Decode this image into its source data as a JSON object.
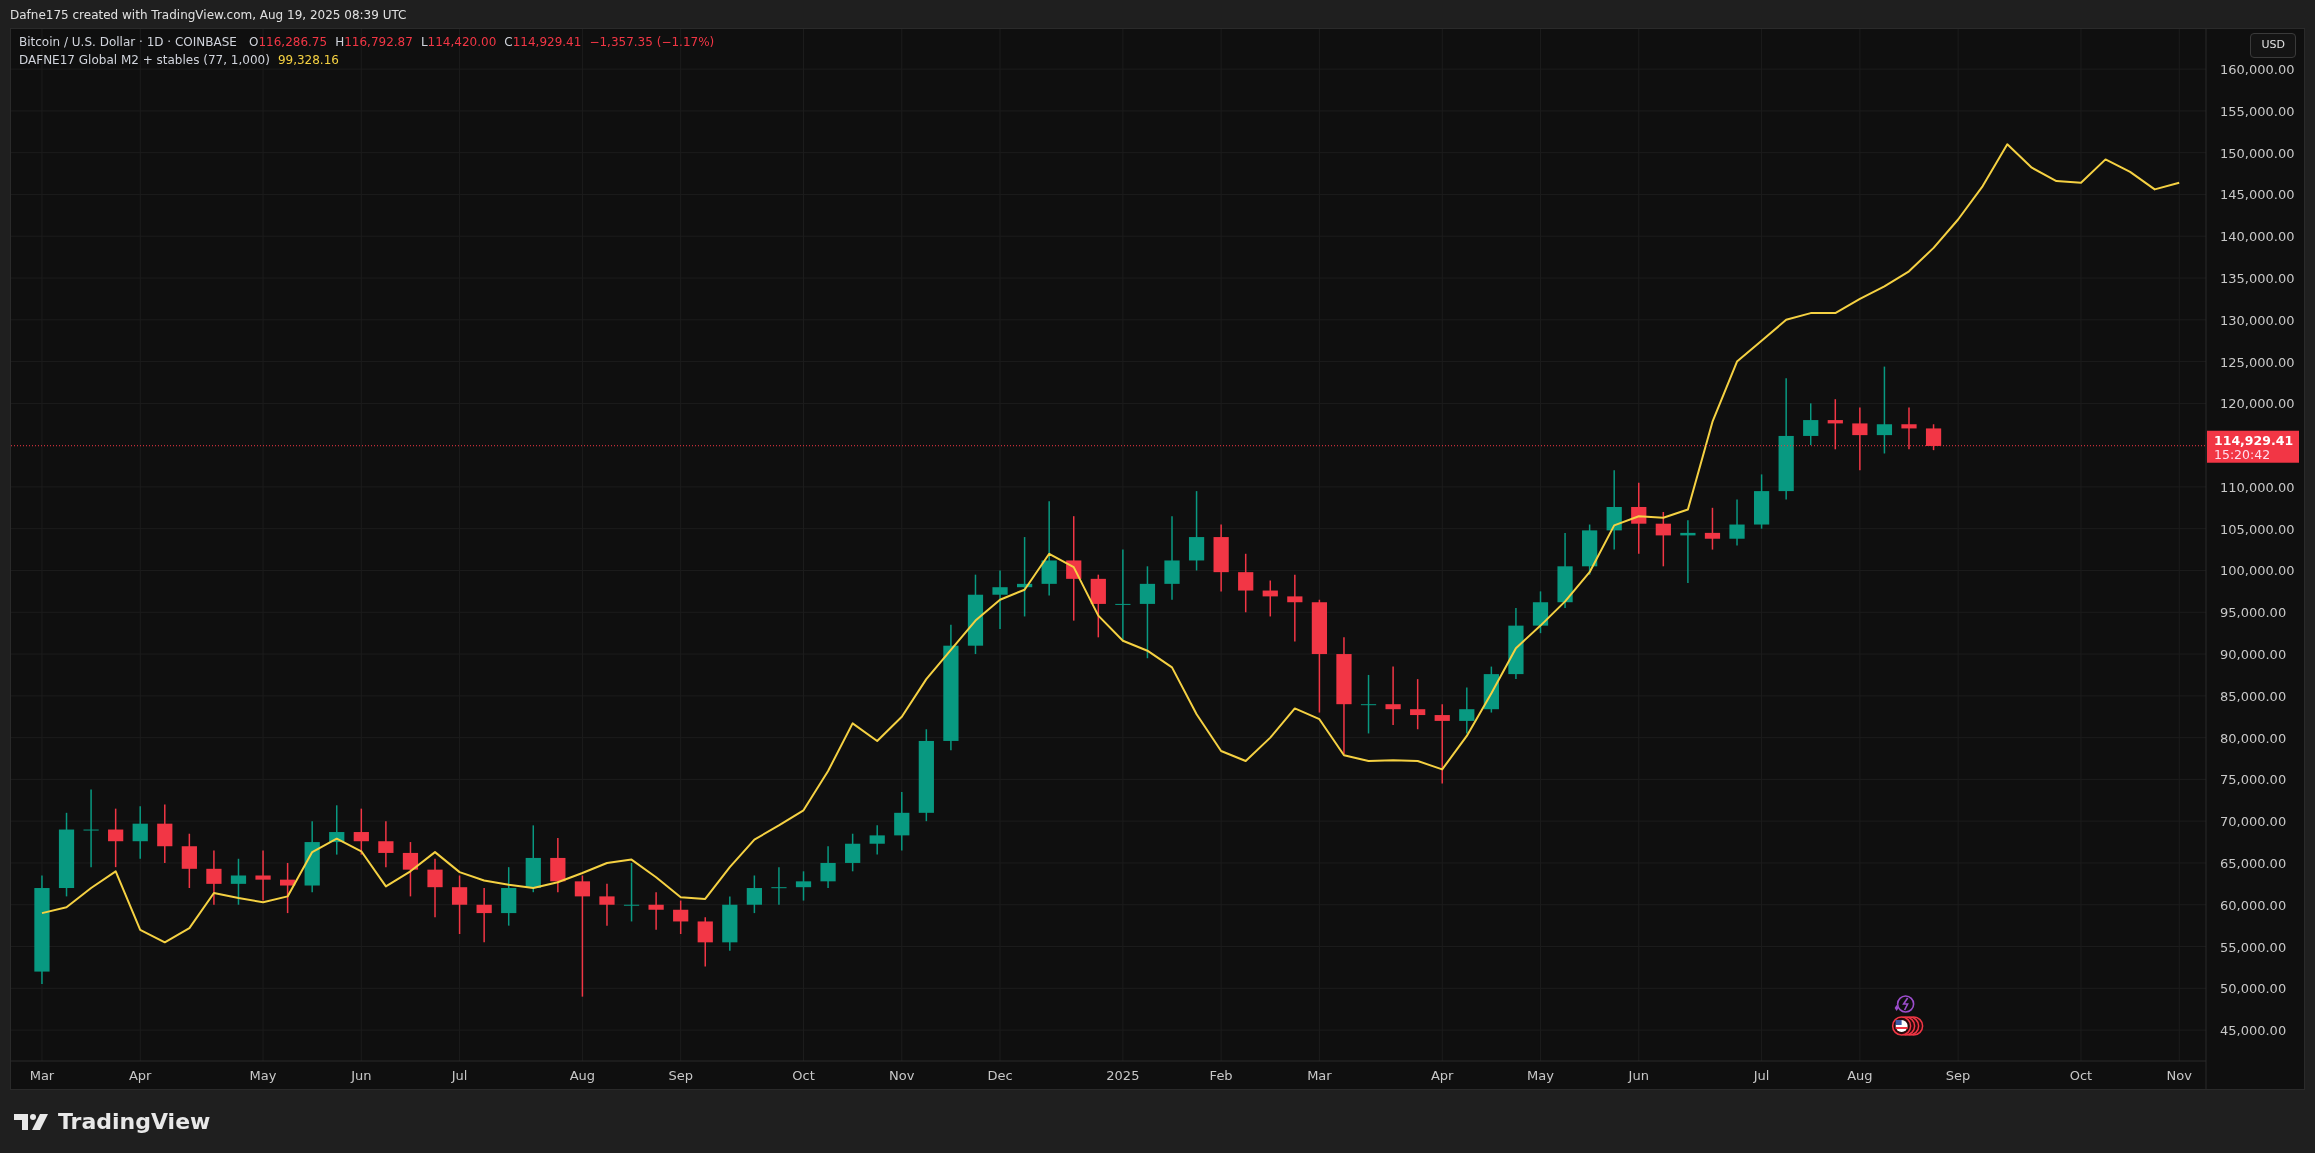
{
  "attribution": "Dafne175 created with TradingView.com, Aug 19, 2025 08:39 UTC",
  "legend": {
    "symbol": "Bitcoin / U.S. Dollar · 1D · COINBASE",
    "ohlc": [
      {
        "label": "O",
        "value": "116,286.75"
      },
      {
        "label": "H",
        "value": "116,792.87"
      },
      {
        "label": "L",
        "value": "114,420.00"
      },
      {
        "label": "C",
        "value": "114,929.41"
      }
    ],
    "change": "−1,357.35 (−1.17%)",
    "indicator": {
      "value": "99,328.16"
    }
  },
  "currency_button": "USD",
  "last_price": {
    "countdown": "15:20:42"
  },
  "chart_data": {
    "type": "candlestick",
    "ylim": [
      41300,
      164800
    ],
    "grid": true,
    "ref_lines": [
      {
        "axis": "y",
        "value": 114929.41,
        "label": "114,929.41",
        "color": "#f23645"
      }
    ],
    "categories": [
      "Mar",
      null,
      null,
      null,
      "Apr",
      null,
      null,
      null,
      null,
      "May",
      null,
      null,
      null,
      "Jun",
      null,
      null,
      null,
      "Jul",
      null,
      null,
      null,
      null,
      "Aug",
      null,
      null,
      null,
      "Sep",
      null,
      null,
      null,
      null,
      "Oct",
      null,
      null,
      null,
      "Nov",
      null,
      null,
      null,
      "Dec",
      null,
      null,
      null,
      null,
      "2025",
      null,
      null,
      null,
      "Feb",
      null,
      null,
      null,
      "Mar",
      null,
      null,
      null,
      null,
      "Apr",
      null,
      null,
      null,
      "May",
      null,
      null,
      null,
      "Jun",
      null,
      null,
      null,
      null,
      "Jul",
      null,
      null,
      null,
      "Aug",
      null,
      null,
      null,
      "Sep",
      null,
      null,
      null,
      null,
      "Oct",
      null,
      null,
      null,
      "Nov"
    ],
    "ohlc": [
      [
        52000,
        63500,
        50500,
        62000
      ],
      [
        62000,
        71000,
        61000,
        69000
      ],
      [
        69000,
        73800,
        64500,
        69000
      ],
      [
        69000,
        71500,
        64500,
        67600
      ],
      [
        67600,
        71800,
        65500,
        69700
      ],
      [
        69700,
        72000,
        65000,
        67000
      ],
      [
        67000,
        68500,
        62000,
        64300
      ],
      [
        64300,
        66500,
        60000,
        62500
      ],
      [
        62500,
        65500,
        60000,
        63500
      ],
      [
        63500,
        66500,
        60500,
        63000
      ],
      [
        63000,
        65000,
        59000,
        62300
      ],
      [
        62300,
        70000,
        61500,
        67500
      ],
      [
        67500,
        71900,
        66000,
        68700
      ],
      [
        68700,
        71500,
        66000,
        67600
      ],
      [
        67600,
        70000,
        64500,
        66200
      ],
      [
        66200,
        67500,
        61000,
        64200
      ],
      [
        64200,
        65500,
        58500,
        62100
      ],
      [
        62100,
        63500,
        56500,
        60000
      ],
      [
        60000,
        62000,
        55500,
        59000
      ],
      [
        59000,
        64500,
        57500,
        62000
      ],
      [
        62000,
        69500,
        61500,
        65600
      ],
      [
        65600,
        68000,
        61500,
        62800
      ],
      [
        62800,
        63500,
        49000,
        61000
      ],
      [
        61000,
        62500,
        57500,
        60000
      ],
      [
        60000,
        65000,
        58000,
        60000
      ],
      [
        60000,
        61500,
        57000,
        59400
      ],
      [
        59400,
        60500,
        56500,
        58000
      ],
      [
        58000,
        58500,
        52600,
        55500
      ],
      [
        55500,
        61000,
        54500,
        60000
      ],
      [
        60000,
        63500,
        59000,
        62000
      ],
      [
        62000,
        64500,
        60000,
        62100
      ],
      [
        62100,
        64000,
        60500,
        62800
      ],
      [
        62800,
        67000,
        62000,
        65000
      ],
      [
        65000,
        68500,
        64000,
        67300
      ],
      [
        67300,
        69500,
        66000,
        68300
      ],
      [
        68300,
        73500,
        66500,
        71000
      ],
      [
        71000,
        81000,
        70000,
        79600
      ],
      [
        79600,
        93500,
        78500,
        91000
      ],
      [
        91000,
        99500,
        90000,
        97100
      ],
      [
        97100,
        100000,
        93000,
        98000
      ],
      [
        98000,
        104000,
        94500,
        98400
      ],
      [
        98400,
        108300,
        97000,
        101200
      ],
      [
        101200,
        106500,
        94000,
        99000
      ],
      [
        99000,
        99500,
        92000,
        96000
      ],
      [
        96000,
        102500,
        91500,
        96000
      ],
      [
        96000,
        100500,
        89500,
        98400
      ],
      [
        98400,
        106500,
        96500,
        101200
      ],
      [
        101200,
        109500,
        100000,
        104000
      ],
      [
        104000,
        105500,
        97500,
        99800
      ],
      [
        99800,
        102000,
        95000,
        97600
      ],
      [
        97600,
        98800,
        94500,
        96900
      ],
      [
        96900,
        99500,
        91500,
        96200
      ],
      [
        96200,
        96500,
        83000,
        90000
      ],
      [
        90000,
        92000,
        78000,
        84000
      ],
      [
        84000,
        87500,
        80500,
        84000
      ],
      [
        84000,
        88500,
        81500,
        83400
      ],
      [
        83400,
        87000,
        81000,
        82700
      ],
      [
        82700,
        84000,
        74500,
        82000
      ],
      [
        82000,
        86000,
        80500,
        83400
      ],
      [
        83400,
        88500,
        83000,
        87600
      ],
      [
        87600,
        95500,
        87000,
        93400
      ],
      [
        93400,
        97500,
        92500,
        96200
      ],
      [
        96200,
        104500,
        95500,
        100500
      ],
      [
        100500,
        105500,
        99500,
        104800
      ],
      [
        104800,
        112000,
        102500,
        107600
      ],
      [
        107600,
        110500,
        102000,
        105600
      ],
      [
        105600,
        107000,
        100500,
        104200
      ],
      [
        104200,
        106000,
        98500,
        104500
      ],
      [
        104500,
        107500,
        102500,
        103800
      ],
      [
        103800,
        108500,
        103000,
        105500
      ],
      [
        105500,
        111500,
        105000,
        109500
      ],
      [
        109500,
        123000,
        108500,
        116100
      ],
      [
        116100,
        120000,
        115000,
        118000
      ],
      [
        118000,
        120500,
        114500,
        117600
      ],
      [
        117600,
        119500,
        112000,
        116200
      ],
      [
        116200,
        124400,
        114000,
        117500
      ],
      [
        117500,
        119500,
        114500,
        117000
      ],
      [
        117000,
        117500,
        114400,
        114900
      ],
      null,
      null,
      null,
      null,
      null,
      null,
      null,
      null,
      null,
      null
    ],
    "series": [
      {
        "name": "DAFNE17 Global M2 + stables (77, 1,000)",
        "type": "line",
        "color": "#f5d142",
        "values": [
          59000,
          59700,
          62000,
          64000,
          57000,
          55500,
          57200,
          61400,
          60800,
          60300,
          61000,
          66300,
          67900,
          66400,
          62200,
          64000,
          66300,
          63900,
          62900,
          62400,
          62000,
          62700,
          63800,
          65000,
          65400,
          63300,
          60900,
          60700,
          64500,
          67800,
          69500,
          71300,
          76000,
          81700,
          79600,
          82500,
          87000,
          90500,
          94000,
          96500,
          97700,
          102000,
          100400,
          94600,
          91600,
          90400,
          88400,
          82800,
          78400,
          77200,
          80000,
          83500,
          82200,
          77900,
          77200,
          77300,
          77200,
          76200,
          80200,
          85300,
          90700,
          93400,
          96300,
          99800,
          105400,
          106500,
          106300,
          107300,
          117800,
          125000,
          127500,
          130000,
          130800,
          130800,
          132500,
          134000,
          135800,
          138600,
          142000,
          146000,
          151000,
          148200,
          146600,
          146400,
          149200,
          147700,
          145600,
          146400
        ]
      }
    ],
    "yticks": [
      {
        "value": 45000,
        "label": "45,000.00"
      },
      {
        "value": 50000,
        "label": "50,000.00"
      },
      {
        "value": 55000,
        "label": "55,000.00"
      },
      {
        "value": 60000,
        "label": "60,000.00"
      },
      {
        "value": 65000,
        "label": "65,000.00"
      },
      {
        "value": 70000,
        "label": "70,000.00"
      },
      {
        "value": 75000,
        "label": "75,000.00"
      },
      {
        "value": 80000,
        "label": "80,000.00"
      },
      {
        "value": 85000,
        "label": "85,000.00"
      },
      {
        "value": 90000,
        "label": "90,000.00"
      },
      {
        "value": 95000,
        "label": "95,000.00"
      },
      {
        "value": 100000,
        "label": "100,000.00"
      },
      {
        "value": 105000,
        "label": "105,000.00"
      },
      {
        "value": 110000,
        "label": "110,000.00"
      },
      {
        "value": 120000,
        "label": "120,000.00"
      },
      {
        "value": 125000,
        "label": "125,000.00"
      },
      {
        "value": 130000,
        "label": "130,000.00"
      },
      {
        "value": 135000,
        "label": "135,000.00"
      },
      {
        "value": 140000,
        "label": "140,000.00"
      },
      {
        "value": 145000,
        "label": "145,000.00"
      },
      {
        "value": 150000,
        "label": "150,000.00"
      },
      {
        "value": 155000,
        "label": "155,000.00"
      },
      {
        "value": 160000,
        "label": "160,000.00"
      }
    ]
  },
  "brand": "TradingView"
}
